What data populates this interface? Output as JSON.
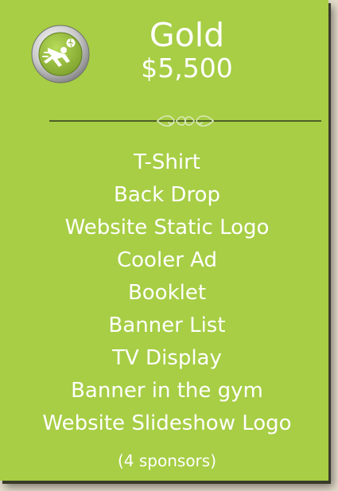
{
  "tier": {
    "name": "Gold",
    "price": "$5,500"
  },
  "benefits": [
    "T-Shirt",
    "Back Drop",
    "Website Static Logo",
    "Cooler Ad",
    "Booklet",
    "Banner List",
    "TV Display",
    "Banner in the gym",
    "Website Slideshow Logo"
  ],
  "note": "(4 sponsors)",
  "icons": {
    "badge": "volleyball-player-icon",
    "divider": "ornamental-flourish-icon"
  },
  "colors": {
    "card": "#a7ce45",
    "background": "#e3dccb",
    "text": "#ffffff",
    "divider": "#2f3a1c",
    "badge_ring": "#c9c9c9",
    "badge_inner": "#9cc43c"
  }
}
